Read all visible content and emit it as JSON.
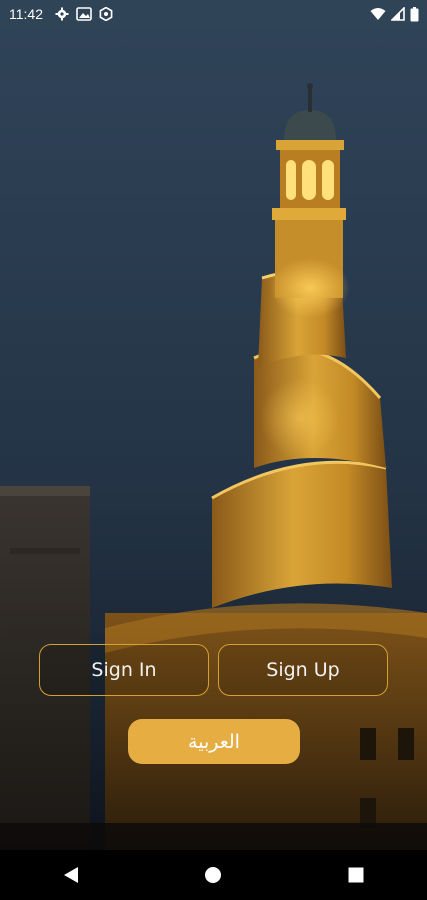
{
  "status_bar": {
    "time": "11:42",
    "left_icons": [
      "gear-icon",
      "image-icon",
      "settings-badge-icon"
    ],
    "right_icons": [
      "wifi-icon",
      "signal-icon",
      "battery-icon"
    ]
  },
  "background": {
    "description_icon": "spiral-minaret-photo",
    "sky_color_top": "#2e4156",
    "sky_color_bottom": "#1a2633",
    "tower_color": "#d39a2c"
  },
  "actions": {
    "sign_in_label": "Sign In",
    "sign_up_label": "Sign Up",
    "language_label": "العربية"
  },
  "colors": {
    "accent": "#e6ad43",
    "outline": "#d4a030"
  },
  "nav_bar": {
    "icons": [
      "back-icon",
      "home-icon",
      "recents-icon"
    ]
  }
}
